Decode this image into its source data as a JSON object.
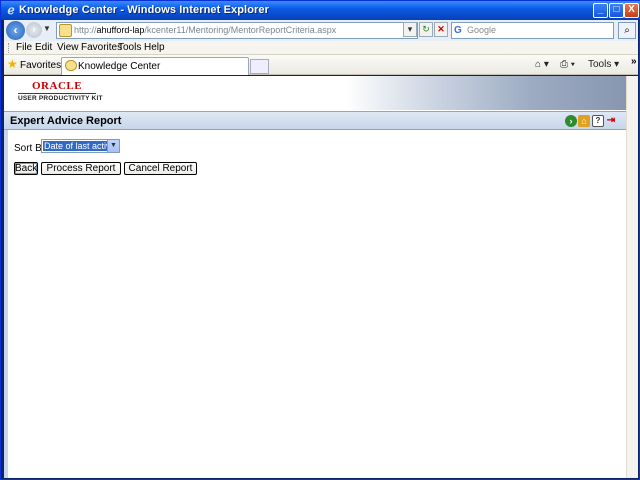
{
  "window": {
    "title": "Knowledge Center - Windows Internet Explorer",
    "controls": {
      "minimize": "_",
      "maximize": "□",
      "close": "X"
    }
  },
  "address_bar": {
    "url_prefix": "http://",
    "url_host": "ahufford-lap",
    "url_path": "/kcenter11/Mentoring/MentorReportCriteria.aspx",
    "search_placeholder": "Google"
  },
  "menu": {
    "items": [
      "File",
      "Edit",
      "View",
      "Favorites",
      "Tools",
      "Help"
    ]
  },
  "favorites_bar": {
    "favorites_label": "Favorites",
    "tab_label": "Knowledge Center",
    "tools_label": "Tools",
    "chevron": "»"
  },
  "header": {
    "brand": "ORACLE",
    "subtitle": "USER PRODUCTIVITY KIT"
  },
  "report": {
    "title": "Expert Advice Report",
    "sort_label": "Sort By",
    "sort_selected": "Date of last activity",
    "buttons": {
      "back": "Back",
      "process": "Process Report",
      "cancel": "Cancel Report"
    }
  },
  "icons": {
    "ie": "ie-icon",
    "go": "go-icon",
    "home": "home-icon",
    "help": "help-icon",
    "exit": "exit-icon"
  },
  "colors": {
    "titlebar": "#0a5be6",
    "report_bar": "#c7d7ea",
    "oracle_red": "#cc0000",
    "selection": "#316ac5"
  }
}
